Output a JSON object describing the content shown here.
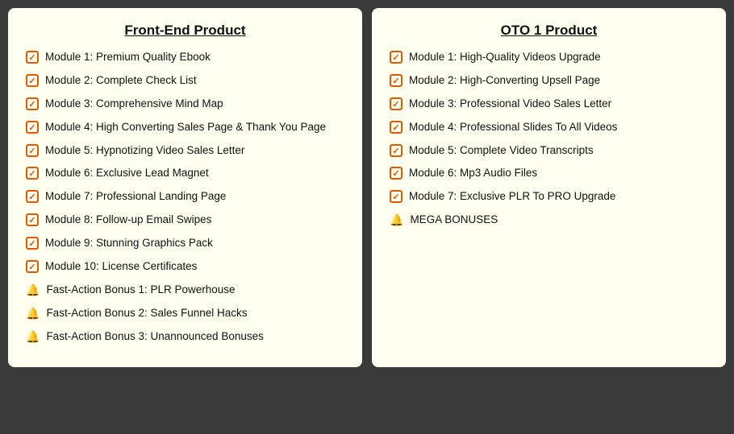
{
  "left_column": {
    "title": "Front-End Product",
    "items": [
      {
        "icon": "check",
        "text": "Module 1: Premium Quality Ebook"
      },
      {
        "icon": "check",
        "text": "Module 2: Complete Check List"
      },
      {
        "icon": "check",
        "text": "Module 3: Comprehensive Mind Map"
      },
      {
        "icon": "check",
        "text": "Module 4: High Converting Sales Page & Thank You Page"
      },
      {
        "icon": "check",
        "text": "Module 5: Hypnotizing Video Sales Letter"
      },
      {
        "icon": "check",
        "text": "Module 6: Exclusive Lead Magnet"
      },
      {
        "icon": "check",
        "text": "Module 7: Professional Landing Page"
      },
      {
        "icon": "check",
        "text": "Module 8: Follow-up Email Swipes"
      },
      {
        "icon": "check",
        "text": "Module 9: Stunning Graphics Pack"
      },
      {
        "icon": "check",
        "text": "Module 10: License Certificates"
      },
      {
        "icon": "bell",
        "text": "Fast-Action Bonus 1: PLR Powerhouse"
      },
      {
        "icon": "bell",
        "text": "Fast-Action Bonus 2: Sales Funnel Hacks"
      },
      {
        "icon": "bell",
        "text": "Fast-Action Bonus 3: Unannounced Bonuses"
      }
    ]
  },
  "right_column": {
    "title": "OTO 1 Product",
    "items": [
      {
        "icon": "check",
        "text": "Module 1: High-Quality Videos Upgrade"
      },
      {
        "icon": "check",
        "text": "Module 2: High-Converting Upsell Page"
      },
      {
        "icon": "check",
        "text": "Module 3: Professional Video Sales Letter"
      },
      {
        "icon": "check",
        "text": "Module 4: Professional Slides To All Videos"
      },
      {
        "icon": "check",
        "text": "Module 5: Complete Video Transcripts"
      },
      {
        "icon": "check",
        "text": "Module 6: Mp3 Audio Files"
      },
      {
        "icon": "check",
        "text": "Module 7: Exclusive PLR To PRO Upgrade"
      },
      {
        "icon": "bell",
        "text": "MEGA BONUSES"
      }
    ]
  }
}
